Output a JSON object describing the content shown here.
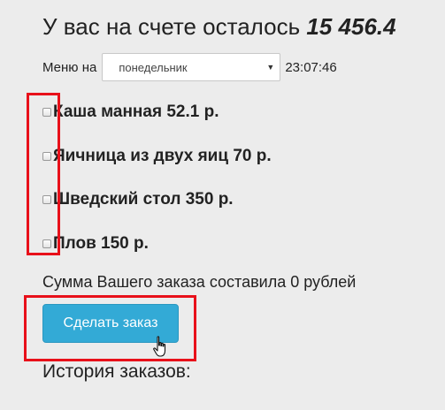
{
  "balance": {
    "prefix": "У вас на счете осталось",
    "amount": "15 456.4"
  },
  "menu": {
    "label": "Меню на",
    "selected_day": "понедельник",
    "time": "23:07:46"
  },
  "items": [
    {
      "label": "Каша манная 52.1 р.",
      "checked": false
    },
    {
      "label": "Яичница из двух яиц 70 р.",
      "checked": false
    },
    {
      "label": "Шведский стол 350 р.",
      "checked": false
    },
    {
      "label": "Плов 150 р.",
      "checked": false
    }
  ],
  "order_sum_text": "Сумма Вашего заказа составила 0 рублей",
  "order_button_label": "Сделать заказ",
  "history_label": "История заказов:",
  "icons": {
    "dropdown": "chevron-down-icon",
    "cursor": "hand-pointer-icon"
  },
  "colors": {
    "accent_button": "#33aad6",
    "highlight": "#e8101a",
    "background": "#ececec"
  }
}
